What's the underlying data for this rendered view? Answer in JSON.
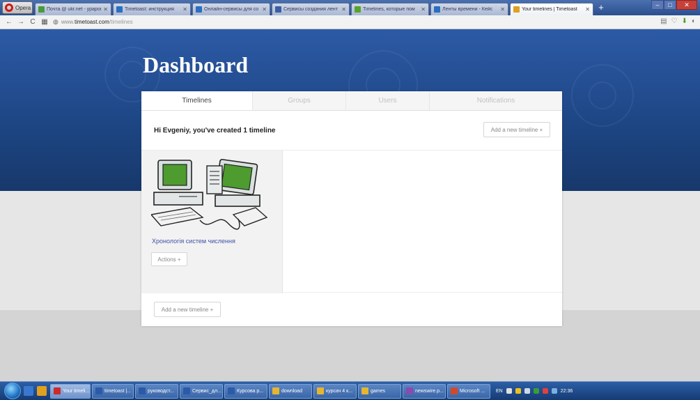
{
  "browser": {
    "menu_label": "Opera",
    "tabs": [
      {
        "label": "Почта @ ukr.net - ураров",
        "icon": "mail-icon",
        "color": "#4b9a3a"
      },
      {
        "label": "Timetoast: инструкция",
        "icon": "timetoast-icon",
        "color": "#2a6fc0"
      },
      {
        "label": "Онлайн-сервисы для со",
        "icon": "timetoast-icon",
        "color": "#2a6fc0"
      },
      {
        "label": "Сервисы создания лент",
        "icon": "doc-icon",
        "color": "#3b5fa0"
      },
      {
        "label": "Timelines, которые пом",
        "icon": "leaf-icon",
        "color": "#58a32a"
      },
      {
        "label": "Ленты времени - Кейс",
        "icon": "timetoast-icon",
        "color": "#2a6fc0"
      },
      {
        "label": "Your timelines | Timetoast",
        "icon": "timetoast-check-icon",
        "color": "#e0a020"
      }
    ],
    "new_tab": "+",
    "address": {
      "prefix": "www.",
      "domain": "timetoast.com",
      "path": "/timelines"
    }
  },
  "page": {
    "title": "Dashboard",
    "tabs": [
      {
        "label": "Timelines",
        "active": true
      },
      {
        "label": "Groups",
        "active": false
      },
      {
        "label": "Users",
        "active": false
      },
      {
        "label": "Notifications",
        "active": false
      }
    ],
    "greeting": "Hi Evgeniy, you've created 1 timeline",
    "add_timeline_top": "Add a new timeline +",
    "timeline": {
      "title": "Хронологія систем числення",
      "actions_label": "Actions +"
    },
    "add_timeline_bottom": "Add a new timeline +"
  },
  "taskbar": {
    "items": [
      {
        "label": "Your timeli...",
        "icon": "opera-icon",
        "color": "#cc2a2a",
        "active": true
      },
      {
        "label": "timetoast |...",
        "icon": "word-icon",
        "color": "#2b5aa8"
      },
      {
        "label": "руководст...",
        "icon": "word-icon",
        "color": "#2b5aa8"
      },
      {
        "label": "Сервис_дл...",
        "icon": "word-icon",
        "color": "#2b5aa8"
      },
      {
        "label": "Курсова р...",
        "icon": "word-icon",
        "color": "#2b5aa8"
      },
      {
        "label": "download",
        "icon": "folder-icon",
        "color": "#e6b530"
      },
      {
        "label": "курсач 4 к...",
        "icon": "folder-icon",
        "color": "#e6b530"
      },
      {
        "label": "games",
        "icon": "folder-icon",
        "color": "#e6b530"
      },
      {
        "label": "newswire.p...",
        "icon": "image-icon",
        "color": "#8a4ab0"
      },
      {
        "label": "Microsoft ...",
        "icon": "office-icon",
        "color": "#d04a2a"
      }
    ],
    "language": "EN",
    "clock": "22:36"
  }
}
